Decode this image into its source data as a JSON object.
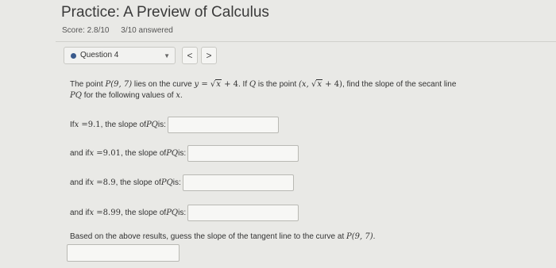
{
  "header": {
    "title": "Practice: A Preview of Calculus",
    "score": "Score: 2.8/10",
    "answered": "3/10 answered"
  },
  "question_nav": {
    "selected": "Question 4",
    "prev_label": "<",
    "next_label": ">"
  },
  "problem": {
    "p1": "The point ",
    "point": "P(9, 7)",
    "p2": " lies on the curve ",
    "y_eq": "y = ",
    "sqrt_x": "x",
    "plus4": " + 4",
    "p3": ". If ",
    "Q": "Q",
    "p4": " is the point ",
    "q_open": "(x, ",
    "q_sqrt": "x",
    "q_close": " + 4)",
    "p5": ", find the slope of the secant line ",
    "PQ": "PQ",
    "p6": " for the following values of ",
    "xvar": "x",
    "p7": "."
  },
  "rows": [
    {
      "prefix": "If ",
      "x_eq": "x = ",
      "value": "9.1",
      "suffix": ", the slope of ",
      "pq": "PQ",
      "end": " is:"
    },
    {
      "prefix": "and if ",
      "x_eq": "x = ",
      "value": "9.01",
      "suffix": ", the slope of ",
      "pq": "PQ",
      "end": " is:"
    },
    {
      "prefix": "and if ",
      "x_eq": "x = ",
      "value": "8.9",
      "suffix": ", the slope of ",
      "pq": "PQ",
      "end": " is:"
    },
    {
      "prefix": "and if ",
      "x_eq": "x = ",
      "value": "8.99",
      "suffix": ", the slope of ",
      "pq": "PQ",
      "end": " is:"
    }
  ],
  "final": {
    "text": "Based on the above results, guess the slope of the tangent line to the curve at ",
    "point": "P(9, 7)",
    "end": "."
  },
  "colors": {
    "background": "#e9e9e6",
    "question_dot": "#3a5a8c"
  }
}
